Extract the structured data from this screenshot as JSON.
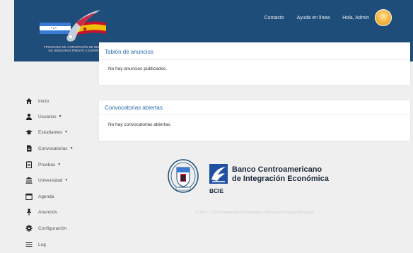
{
  "header": {
    "logo_caption": "PROGRAMA DE CONVERSIÓN DE DEUDA\nDE HONDURAS FRENTE A ESPAÑA",
    "nav": {
      "contact": "Contacto",
      "help": "Ayuda en línea",
      "greeting": "Hola, Admin"
    }
  },
  "announcements": {
    "title": "Tablón de anuncios",
    "empty": "No hay anuncios publicados."
  },
  "calls": {
    "title": "Convocatorias abiertas",
    "empty": "No hay convocatorias abiertas."
  },
  "sidebar": {
    "items": [
      {
        "label": "Inicio",
        "icon": "home-icon",
        "dropdown": false
      },
      {
        "label": "Usuarios",
        "icon": "user-icon",
        "dropdown": true
      },
      {
        "label": "Estudiantes",
        "icon": "graduation-cap-icon",
        "dropdown": true
      },
      {
        "label": "Convocatorias",
        "icon": "document-icon",
        "dropdown": true
      },
      {
        "label": "Pruebas",
        "icon": "clipboard-icon",
        "dropdown": true
      },
      {
        "label": "Universidad",
        "icon": "university-icon",
        "dropdown": true
      },
      {
        "label": "Agenda",
        "icon": "calendar-icon",
        "dropdown": false
      },
      {
        "label": "Anuncios",
        "icon": "pin-icon",
        "dropdown": false
      },
      {
        "label": "Configuración",
        "icon": "gear-icon",
        "dropdown": false
      },
      {
        "label": "Log",
        "icon": "list-icon",
        "dropdown": false
      }
    ]
  },
  "footer": {
    "upnfm_seal_text": "HONDURAS",
    "bcie_name": "Banco Centroamericano\nde Integración Económica",
    "bcie_short": "BCIE",
    "copyright": "© 2017 - 2018 Universidad Pedagógica Nacional Francisco Morazán"
  },
  "colors": {
    "header_bg": "#1f4d7a",
    "accent": "#2a6cae",
    "page_bg": "#efefef"
  }
}
